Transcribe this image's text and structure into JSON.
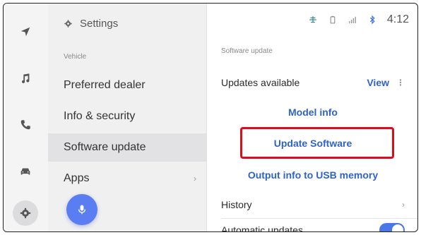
{
  "menu": {
    "header": "Settings",
    "section": "Vehicle",
    "items": [
      {
        "label": "Preferred dealer"
      },
      {
        "label": "Info & security"
      },
      {
        "label": "Software update"
      },
      {
        "label": "Apps"
      }
    ]
  },
  "status": {
    "time": "4:12"
  },
  "content": {
    "section": "Software update",
    "updates_label": "Updates available",
    "view_label": "View",
    "model_info": "Model info",
    "update_software": "Update Software",
    "output_usb": "Output info to USB memory",
    "history": "History",
    "automatic_updates": "Automatic updates",
    "automatic_updates_on": true
  },
  "colors": {
    "accent": "#2f63c9",
    "highlight_box": "#d6111c",
    "toggle_on": "#4a76e8",
    "mic": "#5a7ef2"
  }
}
